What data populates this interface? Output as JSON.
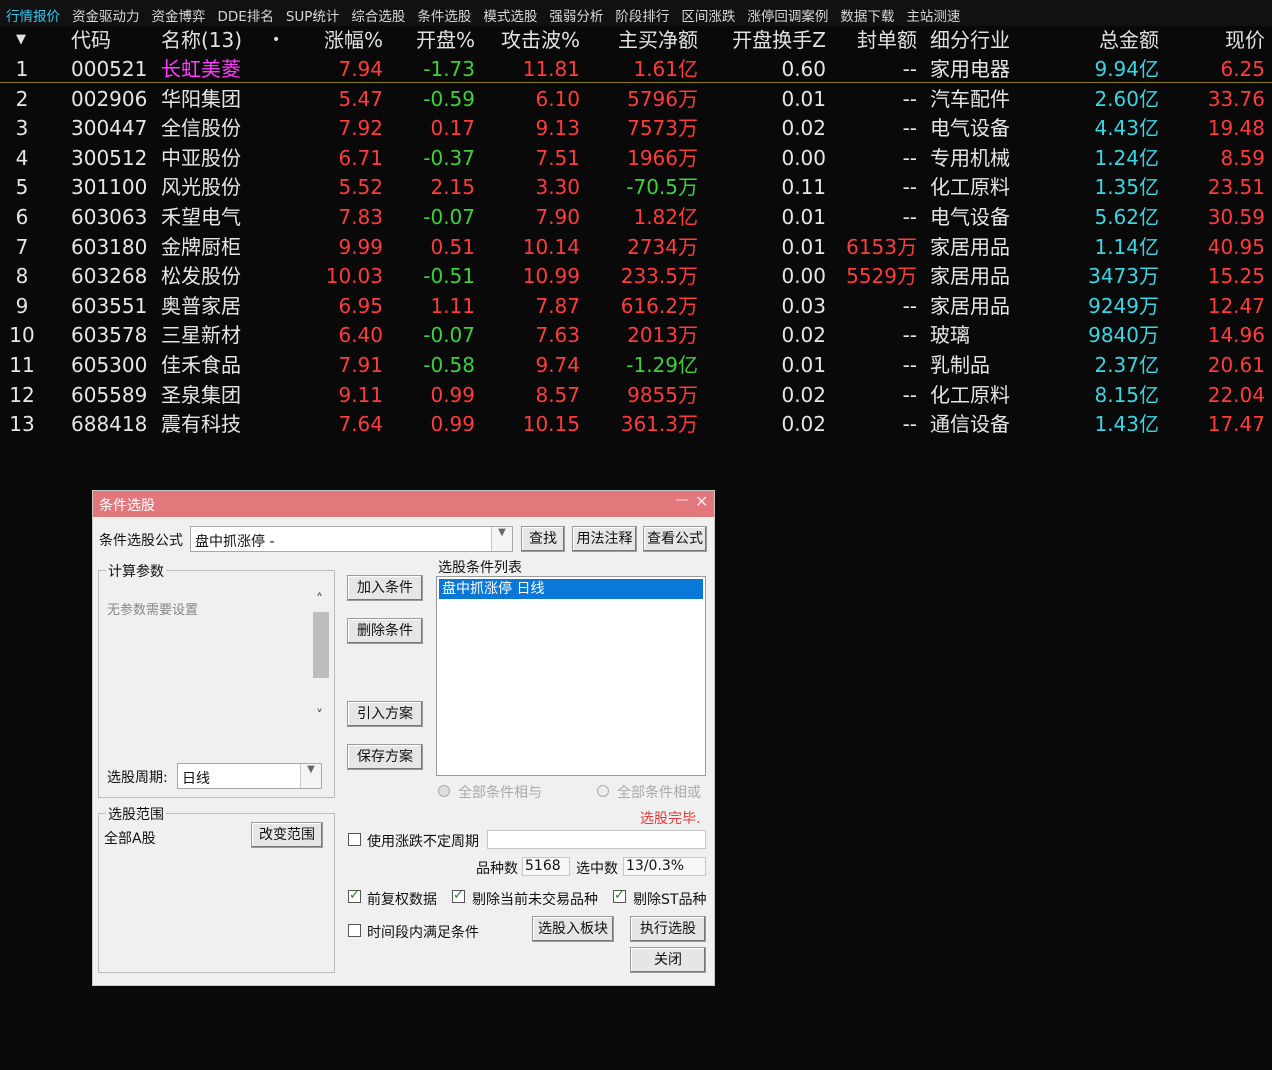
{
  "tabs": [
    "行情报价",
    "资金驱动力",
    "资金博弈",
    "DDE排名",
    "SUP统计",
    "综合选股",
    "条件选股",
    "模式选股",
    "强弱分析",
    "阶段排行",
    "区间涨跌",
    "涨停回调案例",
    "数据下载",
    "主站测速"
  ],
  "header": {
    "sort_icon": "▼",
    "code": "代码",
    "name": "名称(13)",
    "dot": "•",
    "zf": "涨幅%",
    "kp": "开盘%",
    "gj": "攻击波%",
    "zm": "主买净额",
    "hs": "开盘换手Z",
    "fd": "封单额",
    "hy": "细分行业",
    "ze": "总金额",
    "xj": "现价"
  },
  "colors": {
    "up": "#ff3b3b",
    "down": "#3bd23b",
    "amount": "#39d6e6",
    "selected_name": "#ff3bff",
    "dialog_title": "#e2777c"
  },
  "rows": [
    {
      "seq": "1",
      "code": "000521",
      "name": "长虹美菱",
      "zf": "7.94",
      "kp": "-1.73",
      "gj": "11.81",
      "zm": "1.61亿",
      "hs": "0.60",
      "fd": "--",
      "hy": "家用电器",
      "ze": "9.94亿",
      "xj": "6.25"
    },
    {
      "seq": "2",
      "code": "002906",
      "name": "华阳集团",
      "zf": "5.47",
      "kp": "-0.59",
      "gj": "6.10",
      "zm": "5796万",
      "hs": "0.01",
      "fd": "--",
      "hy": "汽车配件",
      "ze": "2.60亿",
      "xj": "33.76"
    },
    {
      "seq": "3",
      "code": "300447",
      "name": "全信股份",
      "zf": "7.92",
      "kp": "0.17",
      "gj": "9.13",
      "zm": "7573万",
      "hs": "0.02",
      "fd": "--",
      "hy": "电气设备",
      "ze": "4.43亿",
      "xj": "19.48"
    },
    {
      "seq": "4",
      "code": "300512",
      "name": "中亚股份",
      "zf": "6.71",
      "kp": "-0.37",
      "gj": "7.51",
      "zm": "1966万",
      "hs": "0.00",
      "fd": "--",
      "hy": "专用机械",
      "ze": "1.24亿",
      "xj": "8.59"
    },
    {
      "seq": "5",
      "code": "301100",
      "name": "风光股份",
      "zf": "5.52",
      "kp": "2.15",
      "gj": "3.30",
      "zm": "-70.5万",
      "hs": "0.11",
      "fd": "--",
      "hy": "化工原料",
      "ze": "1.35亿",
      "xj": "23.51"
    },
    {
      "seq": "6",
      "code": "603063",
      "name": "禾望电气",
      "zf": "7.83",
      "kp": "-0.07",
      "gj": "7.90",
      "zm": "1.82亿",
      "hs": "0.01",
      "fd": "--",
      "hy": "电气设备",
      "ze": "5.62亿",
      "xj": "30.59"
    },
    {
      "seq": "7",
      "code": "603180",
      "name": "金牌厨柜",
      "zf": "9.99",
      "kp": "0.51",
      "gj": "10.14",
      "zm": "2734万",
      "hs": "0.01",
      "fd": "6153万",
      "hy": "家居用品",
      "ze": "1.14亿",
      "xj": "40.95"
    },
    {
      "seq": "8",
      "code": "603268",
      "name": "松发股份",
      "zf": "10.03",
      "kp": "-0.51",
      "gj": "10.99",
      "zm": "233.5万",
      "hs": "0.00",
      "fd": "5529万",
      "hy": "家居用品",
      "ze": "3473万",
      "xj": "15.25"
    },
    {
      "seq": "9",
      "code": "603551",
      "name": "奥普家居",
      "zf": "6.95",
      "kp": "1.11",
      "gj": "7.87",
      "zm": "616.2万",
      "hs": "0.03",
      "fd": "--",
      "hy": "家居用品",
      "ze": "9249万",
      "xj": "12.47"
    },
    {
      "seq": "10",
      "code": "603578",
      "name": "三星新材",
      "zf": "6.40",
      "kp": "-0.07",
      "gj": "7.63",
      "zm": "2013万",
      "hs": "0.02",
      "fd": "--",
      "hy": "玻璃",
      "ze": "9840万",
      "xj": "14.96"
    },
    {
      "seq": "11",
      "code": "605300",
      "name": "佳禾食品",
      "zf": "7.91",
      "kp": "-0.58",
      "gj": "9.74",
      "zm": "-1.29亿",
      "hs": "0.01",
      "fd": "--",
      "hy": "乳制品",
      "ze": "2.37亿",
      "xj": "20.61"
    },
    {
      "seq": "12",
      "code": "605589",
      "name": "圣泉集团",
      "zf": "9.11",
      "kp": "0.99",
      "gj": "8.57",
      "zm": "9855万",
      "hs": "0.02",
      "fd": "--",
      "hy": "化工原料",
      "ze": "8.15亿",
      "xj": "22.04"
    },
    {
      "seq": "13",
      "code": "688418",
      "name": "震有科技",
      "zf": "7.64",
      "kp": "0.99",
      "gj": "10.15",
      "zm": "361.3万",
      "hs": "0.02",
      "fd": "--",
      "hy": "通信设备",
      "ze": "1.43亿",
      "xj": "17.47"
    }
  ],
  "dialog": {
    "title": "条件选股",
    "minimize": "—",
    "close": "✕",
    "formula_label": "条件选股公式",
    "formula_value": "盘中抓涨停  -",
    "find": "查找",
    "usage": "用法注释",
    "view_formula": "查看公式",
    "params_group": "计算参数",
    "no_params": "无参数需要设置",
    "scroll_up": "˄",
    "scroll_down": "˅",
    "add_condition": "加入条件",
    "delete_condition": "删除条件",
    "import_plan": "引入方案",
    "save_plan": "保存方案",
    "list_label": "选股条件列表",
    "list_item": "盘中抓涨停  日线",
    "all_and": "全部条件相与",
    "all_or": "全部条件相或",
    "status": "选股完毕.",
    "period_label": "选股周期:",
    "period_value": "日线",
    "range_group": "选股范围",
    "range_value": "全部A股",
    "change_range": "改变范围",
    "use_irregular": "使用涨跌不定周期",
    "count_label": "品种数",
    "count_value": "5168",
    "selected_label": "选中数",
    "selected_value": "13/0.3%",
    "pre_adjust": "前复权数据",
    "remove_untraded": "剔除当前未交易品种",
    "remove_st": "剔除ST品种",
    "time_range": "时间段内满足条件",
    "to_block": "选股入板块",
    "execute": "执行选股",
    "close_btn": "关闭"
  }
}
